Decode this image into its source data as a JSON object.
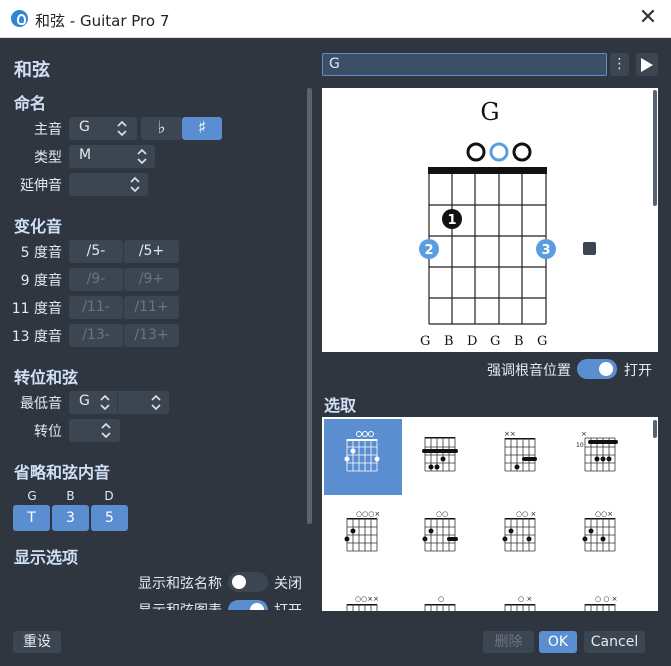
{
  "window": {
    "title": "和弦 - Guitar Pro 7"
  },
  "left": {
    "heading": "和弦",
    "naming": {
      "title": "命名",
      "root_label": "主音",
      "root_value": "G",
      "flat_symbol": "♭",
      "sharp_symbol": "♯",
      "type_label": "类型",
      "type_value": "M",
      "extension_label": "延伸音",
      "extension_value": ""
    },
    "alterations": {
      "title": "变化音",
      "rows": [
        {
          "label": "5 度音",
          "minus": "/5-",
          "plus": "/5+",
          "enabled": true
        },
        {
          "label": "9 度音",
          "minus": "/9-",
          "plus": "/9+",
          "enabled": false
        },
        {
          "label": "11 度音",
          "minus": "/11-",
          "plus": "/11+",
          "enabled": false
        },
        {
          "label": "13 度音",
          "minus": "/13-",
          "plus": "/13+",
          "enabled": false
        }
      ]
    },
    "inversion": {
      "title": "转位和弦",
      "bass_label": "最低音",
      "bass_value": "G",
      "inversion_label": "转位",
      "inversion_value": ""
    },
    "omit": {
      "title": "省略和弦内音",
      "notes": [
        {
          "note": "G",
          "degree": "T"
        },
        {
          "note": "B",
          "degree": "3"
        },
        {
          "note": "D",
          "degree": "5"
        }
      ]
    },
    "display": {
      "title": "显示选项",
      "show_name_label": "显示和弦名称",
      "show_name_state": "关闭",
      "show_diagram_label": "显示和弦图表",
      "show_diagram_state": "打开"
    }
  },
  "right": {
    "chord_input_value": "G",
    "diagram": {
      "name": "G",
      "fingers": [
        "1",
        "2",
        "3"
      ],
      "string_notes": [
        "G",
        "B",
        "D",
        "G",
        "B",
        "G"
      ]
    },
    "emphasize_root_label": "强调根音位置",
    "emphasize_root_state": "打开",
    "selection_title": "选取",
    "thumb_fret_label": "10"
  },
  "footer": {
    "reset_label": "重设",
    "delete_label": "删除",
    "ok_label": "OK",
    "cancel_label": "Cancel"
  },
  "colors": {
    "bg": "#2f3640",
    "control": "#3c4552",
    "accent": "#5b8ed0",
    "heading": "#cfe0f5"
  }
}
